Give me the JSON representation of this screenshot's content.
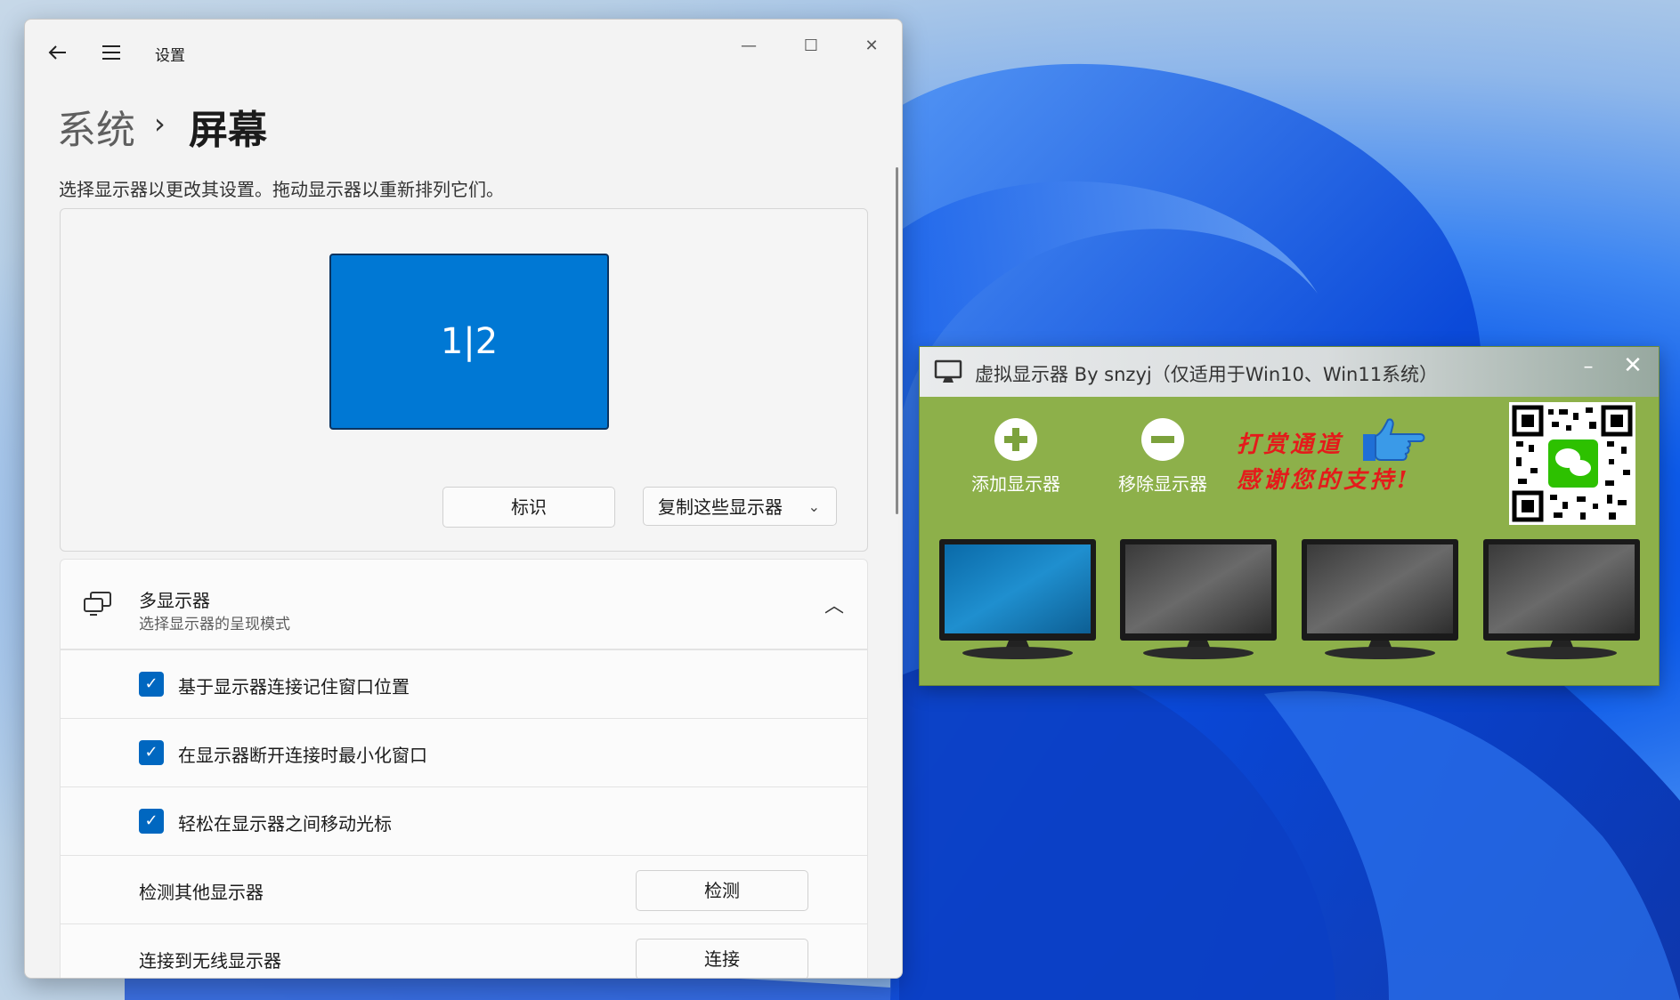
{
  "settings": {
    "title": "设置",
    "window_controls": {
      "minimize": "—",
      "maximize": "☐",
      "close": "✕"
    },
    "breadcrumb": {
      "parent": "系统",
      "separator": "›",
      "current": "屏幕"
    },
    "hint": "选择显示器以更改其设置。拖动显示器以重新排列它们。",
    "monitor_tile_label": "1|2",
    "identify_button": "标识",
    "duplicate_dropdown": {
      "selected": "复制这些显示器",
      "chevron": "⌄"
    },
    "multi_display": {
      "title": "多显示器",
      "subtitle": "选择显示器的呈现模式",
      "chevron": "︿"
    },
    "options": [
      {
        "label": "基于显示器连接记住窗口位置",
        "checked": true
      },
      {
        "label": "在显示器断开连接时最小化窗口",
        "checked": true
      },
      {
        "label": "轻松在显示器之间移动光标",
        "checked": true
      }
    ],
    "detect": {
      "label": "检测其他显示器",
      "button": "检测"
    },
    "wireless": {
      "label": "连接到无线显示器",
      "button": "连接"
    }
  },
  "virtual_display": {
    "title": "虚拟显示器 By snzyj（仅适用于Win10、Win11系统）",
    "minimize": "–",
    "close": "✕",
    "add_label": "添加显示器",
    "remove_label": "移除显示器",
    "support_line1": "打赏通道",
    "support_line2": "感谢您的支持!",
    "monitors": [
      {
        "state": "active"
      },
      {
        "state": "inactive"
      },
      {
        "state": "inactive"
      },
      {
        "state": "inactive"
      }
    ]
  },
  "colors": {
    "accent": "#0078d4",
    "checkbox": "#0067c0",
    "tool_bg": "#8db04a",
    "support_text": "#e41b1b"
  },
  "icons": [
    "back-arrow-icon",
    "hamburger-menu-icon",
    "multi-display-icon",
    "monitor-app-icon",
    "add-circle-icon",
    "remove-circle-icon",
    "pointing-hand-icon",
    "wechat-qr-code",
    "checkmark-icon"
  ]
}
